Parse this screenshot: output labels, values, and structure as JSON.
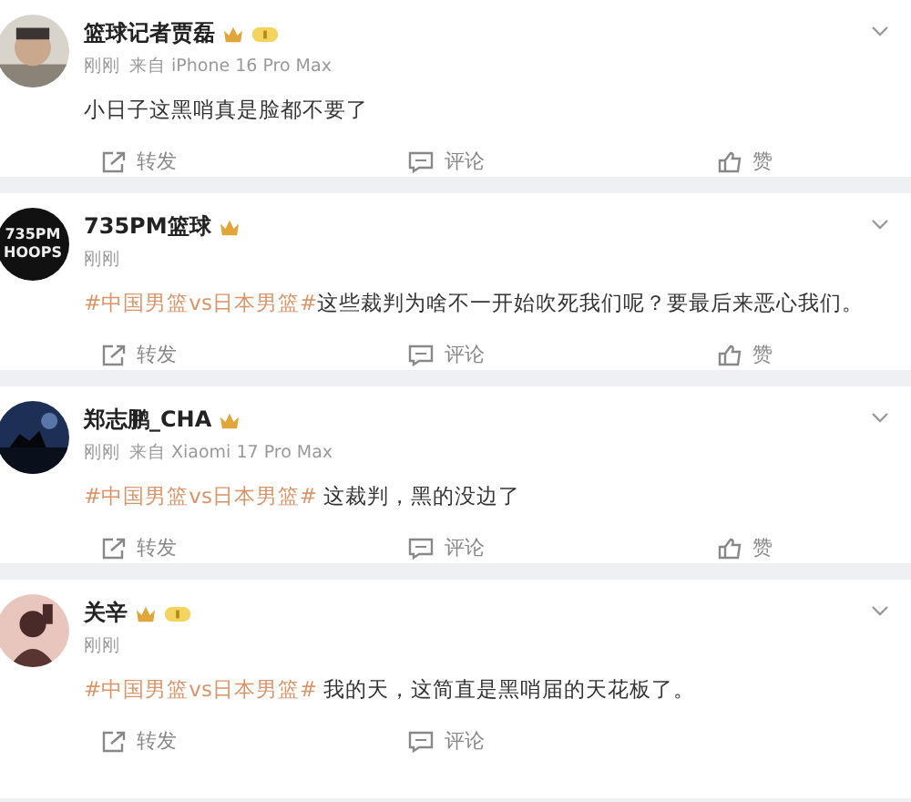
{
  "posts": [
    {
      "avatar": {
        "kind": "picture"
      },
      "name": "篮球记者贾磊",
      "vip": true,
      "level_badge": true,
      "time": "刚刚",
      "source": "来自 iPhone 16 Pro Max",
      "text": "小日子这黑哨真是脸都不要了",
      "actions": [
        {
          "kind": "repost",
          "label": "转发"
        },
        {
          "kind": "comment",
          "label": "评论"
        },
        {
          "kind": "like",
          "label": "赞"
        }
      ]
    },
    {
      "avatar": {
        "kind": "logo",
        "lines": [
          "735PM",
          "HOOPS"
        ]
      },
      "name": "735PM篮球",
      "vip": true,
      "level_badge": false,
      "time": "刚刚",
      "hashtag": "#中国男篮vs日本男篮#",
      "text": "这些裁判为啥不一开始吹死我们呢？要最后来恶心我们。",
      "actions": [
        {
          "kind": "repost",
          "label": "转发"
        },
        {
          "kind": "comment",
          "label": "评论"
        },
        {
          "kind": "like",
          "label": "赞"
        }
      ]
    },
    {
      "avatar": {
        "kind": "picture"
      },
      "name": "郑志鹏_CHA",
      "vip": true,
      "level_badge": false,
      "time": "刚刚",
      "source": "来自 Xiaomi 17 Pro Max",
      "hashtag": "#中国男篮vs日本男篮#",
      "text": " 这裁判，黑的没边了",
      "actions": [
        {
          "kind": "repost",
          "label": "转发"
        },
        {
          "kind": "comment",
          "label": "评论"
        },
        {
          "kind": "like",
          "label": "赞"
        }
      ]
    },
    {
      "avatar": {
        "kind": "picture"
      },
      "name": "关辛",
      "vip": true,
      "level_badge": true,
      "time": "刚刚",
      "hashtag": "#中国男篮vs日本男篮#",
      "text": " 我的天，这简直是黑哨届的天花板了。",
      "actions": [
        {
          "kind": "repost",
          "label": "转发"
        },
        {
          "kind": "comment",
          "label": "评论"
        }
      ]
    }
  ]
}
